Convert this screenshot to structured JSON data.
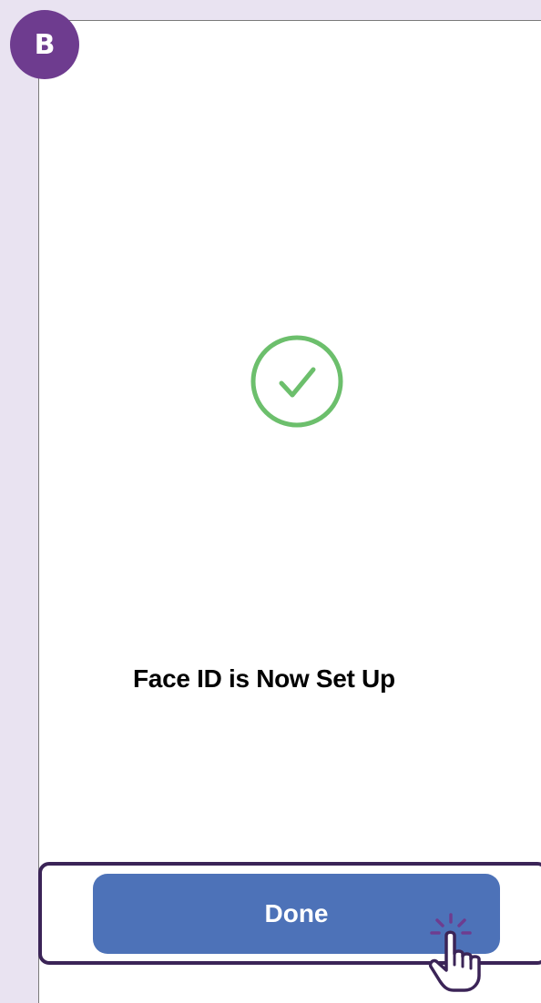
{
  "badge": {
    "label": "B"
  },
  "screen": {
    "icon": "checkmark-circle-icon",
    "message": "Face ID is Now Set Up",
    "done_label": "Done"
  },
  "colors": {
    "badge": "#6e3c8f",
    "check": "#6cbf6c",
    "button": "#4d72b8",
    "highlight": "#3b2457",
    "page_bg": "#e9e3f1"
  },
  "overlay": {
    "pointer_icon": "tap-hand-icon"
  }
}
